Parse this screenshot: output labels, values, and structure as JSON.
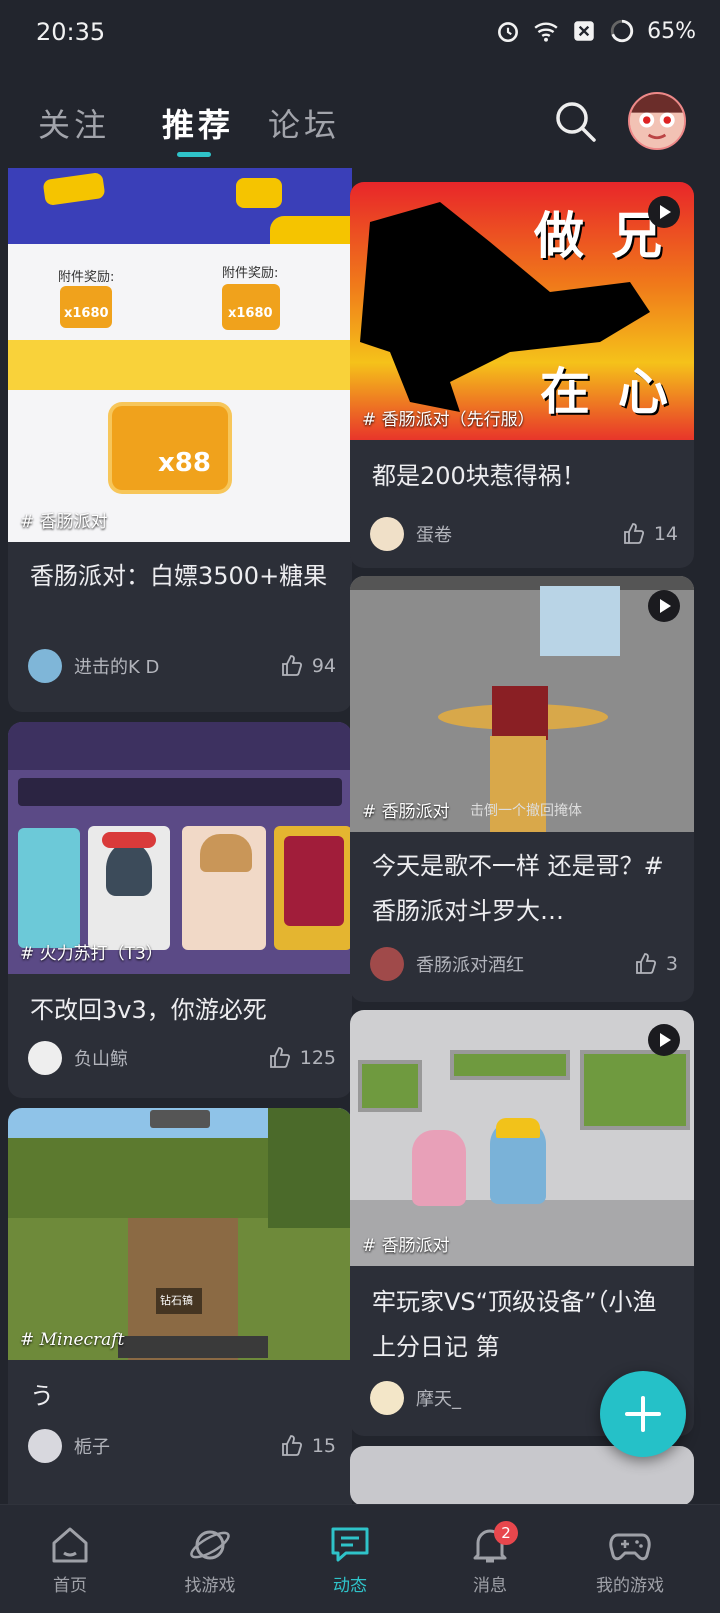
{
  "status_bar": {
    "time": "20:35",
    "battery": "65%"
  },
  "header": {
    "tabs": [
      {
        "label": "关注",
        "active": false
      },
      {
        "label": "推荐",
        "active": true
      },
      {
        "label": "论坛",
        "active": false
      }
    ]
  },
  "feed": {
    "left": [
      {
        "tag": "# 香肠派对",
        "image_text": {
          "reward_label_1": "附件奖励:",
          "reward_label_2": "附件奖励:",
          "amount_small_1": "x1680",
          "amount_small_2": "x1680",
          "amount_big": "x88"
        },
        "title": "香肠派对：白嫖3500+糖果",
        "author": "进击的K D",
        "likes": "94"
      },
      {
        "tag": "# 火力苏打（T3）",
        "title": "不改回3v3，你游必死",
        "author": "负山鲸",
        "likes": "125"
      },
      {
        "tag": "# Minecraft",
        "image_text": {
          "hud_label": "钻石镐"
        },
        "title": "う",
        "author": "栀子",
        "likes": "15"
      }
    ],
    "right": [
      {
        "tag": "# 香肠派对（先行服）",
        "image_text": {
          "big_1": "做",
          "big_2": "兄",
          "big_3": "在",
          "big_4": "心"
        },
        "title": "都是200块惹得祸！",
        "author": "蛋卷",
        "likes": "14"
      },
      {
        "tag": "# 香肠派对",
        "subtag": "击倒一个撤回掩体",
        "title": "今天是歌不一样 还是哥？#香肠派对斗罗大…",
        "author": "香肠派对酒红",
        "likes": "3"
      },
      {
        "tag": "# 香肠派对",
        "title": "牢玩家VS“顶级设备”（小渔上分日记 第",
        "author": "摩天_",
        "likes": ""
      }
    ]
  },
  "bottom_nav": [
    {
      "label": "首页",
      "icon": "home-icon"
    },
    {
      "label": "找游戏",
      "icon": "planet-icon"
    },
    {
      "label": "动态",
      "icon": "message-icon",
      "active": true
    },
    {
      "label": "消息",
      "icon": "bell-icon",
      "badge": "2"
    },
    {
      "label": "我的游戏",
      "icon": "gamepad-icon"
    }
  ],
  "colors": {
    "accent": "#2fc3c9",
    "background": "#22252d",
    "card": "#2c2f38",
    "badge": "#e8474d"
  }
}
